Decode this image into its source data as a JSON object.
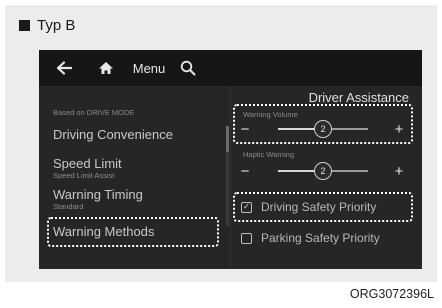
{
  "caption": "Typ B",
  "figure_code": "ORG3072396L",
  "topbar": {
    "back_icon": "back-arrow-icon",
    "home_icon": "home-icon",
    "menu_label": "Menu",
    "search_icon": "search-icon"
  },
  "left_pane": {
    "section_label": "Based on DRIVE MODE",
    "items": [
      {
        "label": "Driving Convenience",
        "sub": ""
      },
      {
        "label": "Speed Limit",
        "sub": "Speed Limit Assist"
      },
      {
        "label": "Warning Timing",
        "sub": "Standard"
      },
      {
        "label": "Warning Methods",
        "sub": ""
      }
    ],
    "selected_item": "Warning Methods"
  },
  "right_pane": {
    "title": "Driver Assistance",
    "warning_volume": {
      "label": "Warning Volume",
      "minus": "−",
      "plus": "+",
      "value": "2",
      "level": 0.5
    },
    "haptic_warning": {
      "label": "Haptic Warning",
      "minus": "−",
      "plus": "+",
      "value": "2",
      "level": 0.5
    },
    "options": [
      {
        "label": "Driving Safety Priority",
        "checked": true
      },
      {
        "label": "Parking Safety Priority",
        "checked": false
      }
    ],
    "check_mark": "✓"
  },
  "colors": {
    "screen_bg": "#262626",
    "topbar_bg": "#161616",
    "highlight_border": "#ffffff",
    "panel_bg": "#ececec"
  }
}
